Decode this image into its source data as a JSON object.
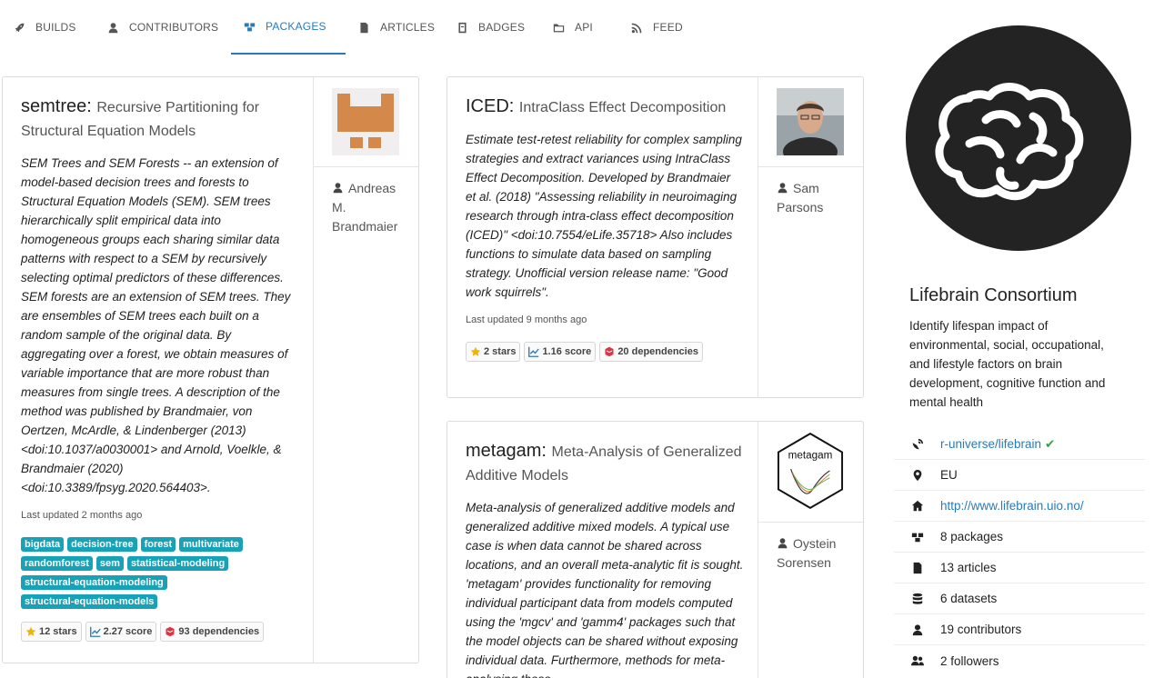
{
  "nav": {
    "items": [
      {
        "label": "BUILDS",
        "icon": "rocket-icon"
      },
      {
        "label": "CONTRIBUTORS",
        "icon": "user-icon"
      },
      {
        "label": "PACKAGES",
        "icon": "cubes-icon",
        "active": true
      },
      {
        "label": "ARTICLES",
        "icon": "file-icon"
      },
      {
        "label": "BADGES",
        "icon": "badge-icon"
      },
      {
        "label": "API",
        "icon": "folder-icon"
      },
      {
        "label": "FEED",
        "icon": "rss-icon"
      }
    ]
  },
  "packages": [
    {
      "name": "semtree:",
      "title": "Recursive Partitioning for Structural Equation Models",
      "description": "SEM Trees and SEM Forests -- an extension of model-based decision trees and forests to Structural Equation Models (SEM). SEM trees hierarchically split empirical data into homogeneous groups each sharing similar data patterns with respect to a SEM by recursively selecting optimal predictors of these differences. SEM forests are an extension of SEM trees. They are ensembles of SEM trees each built on a random sample of the original data. By aggregating over a forest, we obtain measures of variable importance that are more robust than measures from single trees. A description of the method was published by Brandmaier, von Oertzen, McArdle, & Lindenberger (2013) <doi:10.1037/a0030001> and Arnold, Voelkle, & Brandmaier (2020) <doi:10.3389/fpsyg.2020.564403>.",
      "updated": "Last updated 2 months ago",
      "tags": [
        "bigdata",
        "decision-tree",
        "forest",
        "multivariate",
        "randomforest",
        "sem",
        "statistical-modeling",
        "structural-equation-modeling",
        "structural-equation-models"
      ],
      "stars": "12 stars",
      "score": "2.27 score",
      "dependencies": "93 dependencies",
      "author": "Andreas M. Brandmaier"
    },
    {
      "name": "ICED:",
      "title": "IntraClass Effect Decomposition",
      "description": "Estimate test-retest reliability for complex sampling strategies and extract variances using IntraClass Effect Decomposition. Developed by Brandmaier et al. (2018) \"Assessing reliability in neuroimaging research through intra-class effect decomposition (ICED)\" <doi:10.7554/eLife.35718> Also includes functions to simulate data based on sampling strategy. Unofficial version release name: \"Good work squirrels\".",
      "updated": "Last updated 9 months ago",
      "stars": "2 stars",
      "score": "1.16 score",
      "dependencies": "20 dependencies",
      "author": "Sam Parsons"
    },
    {
      "name": "metagam:",
      "title": "Meta-Analysis of Generalized Additive Models",
      "description": "Meta-analysis of generalized additive models and generalized additive mixed models. A typical use case is when data cannot be shared across locations, and an overall meta-analytic fit is sought. 'metagam' provides functionality for removing individual participant data from models computed using the 'mgcv' and 'gamm4' packages such that the model objects can be shared without exposing individual data. Furthermore, methods for meta-analysing these",
      "author": "Oystein Sorensen",
      "logo_text": "metagam"
    }
  ],
  "profile": {
    "name": "Lifebrain Consortium",
    "description": "Identify lifespan impact of environmental, social, occupational, and lifestyle factors on brain development, cognitive function and mental health",
    "repo": "r-universe/lifebrain",
    "location": "EU",
    "website": "http://www.lifebrain.uio.no/",
    "packages": "8 packages",
    "articles": "13 articles",
    "datasets": "6 datasets",
    "contributors": "19 contributors",
    "followers": "2 followers"
  },
  "colors": {
    "accent": "#2a7ab8",
    "tag": "#17a2b8",
    "star": "#f0b400",
    "check": "#28a745",
    "deps": "#dc3545"
  }
}
